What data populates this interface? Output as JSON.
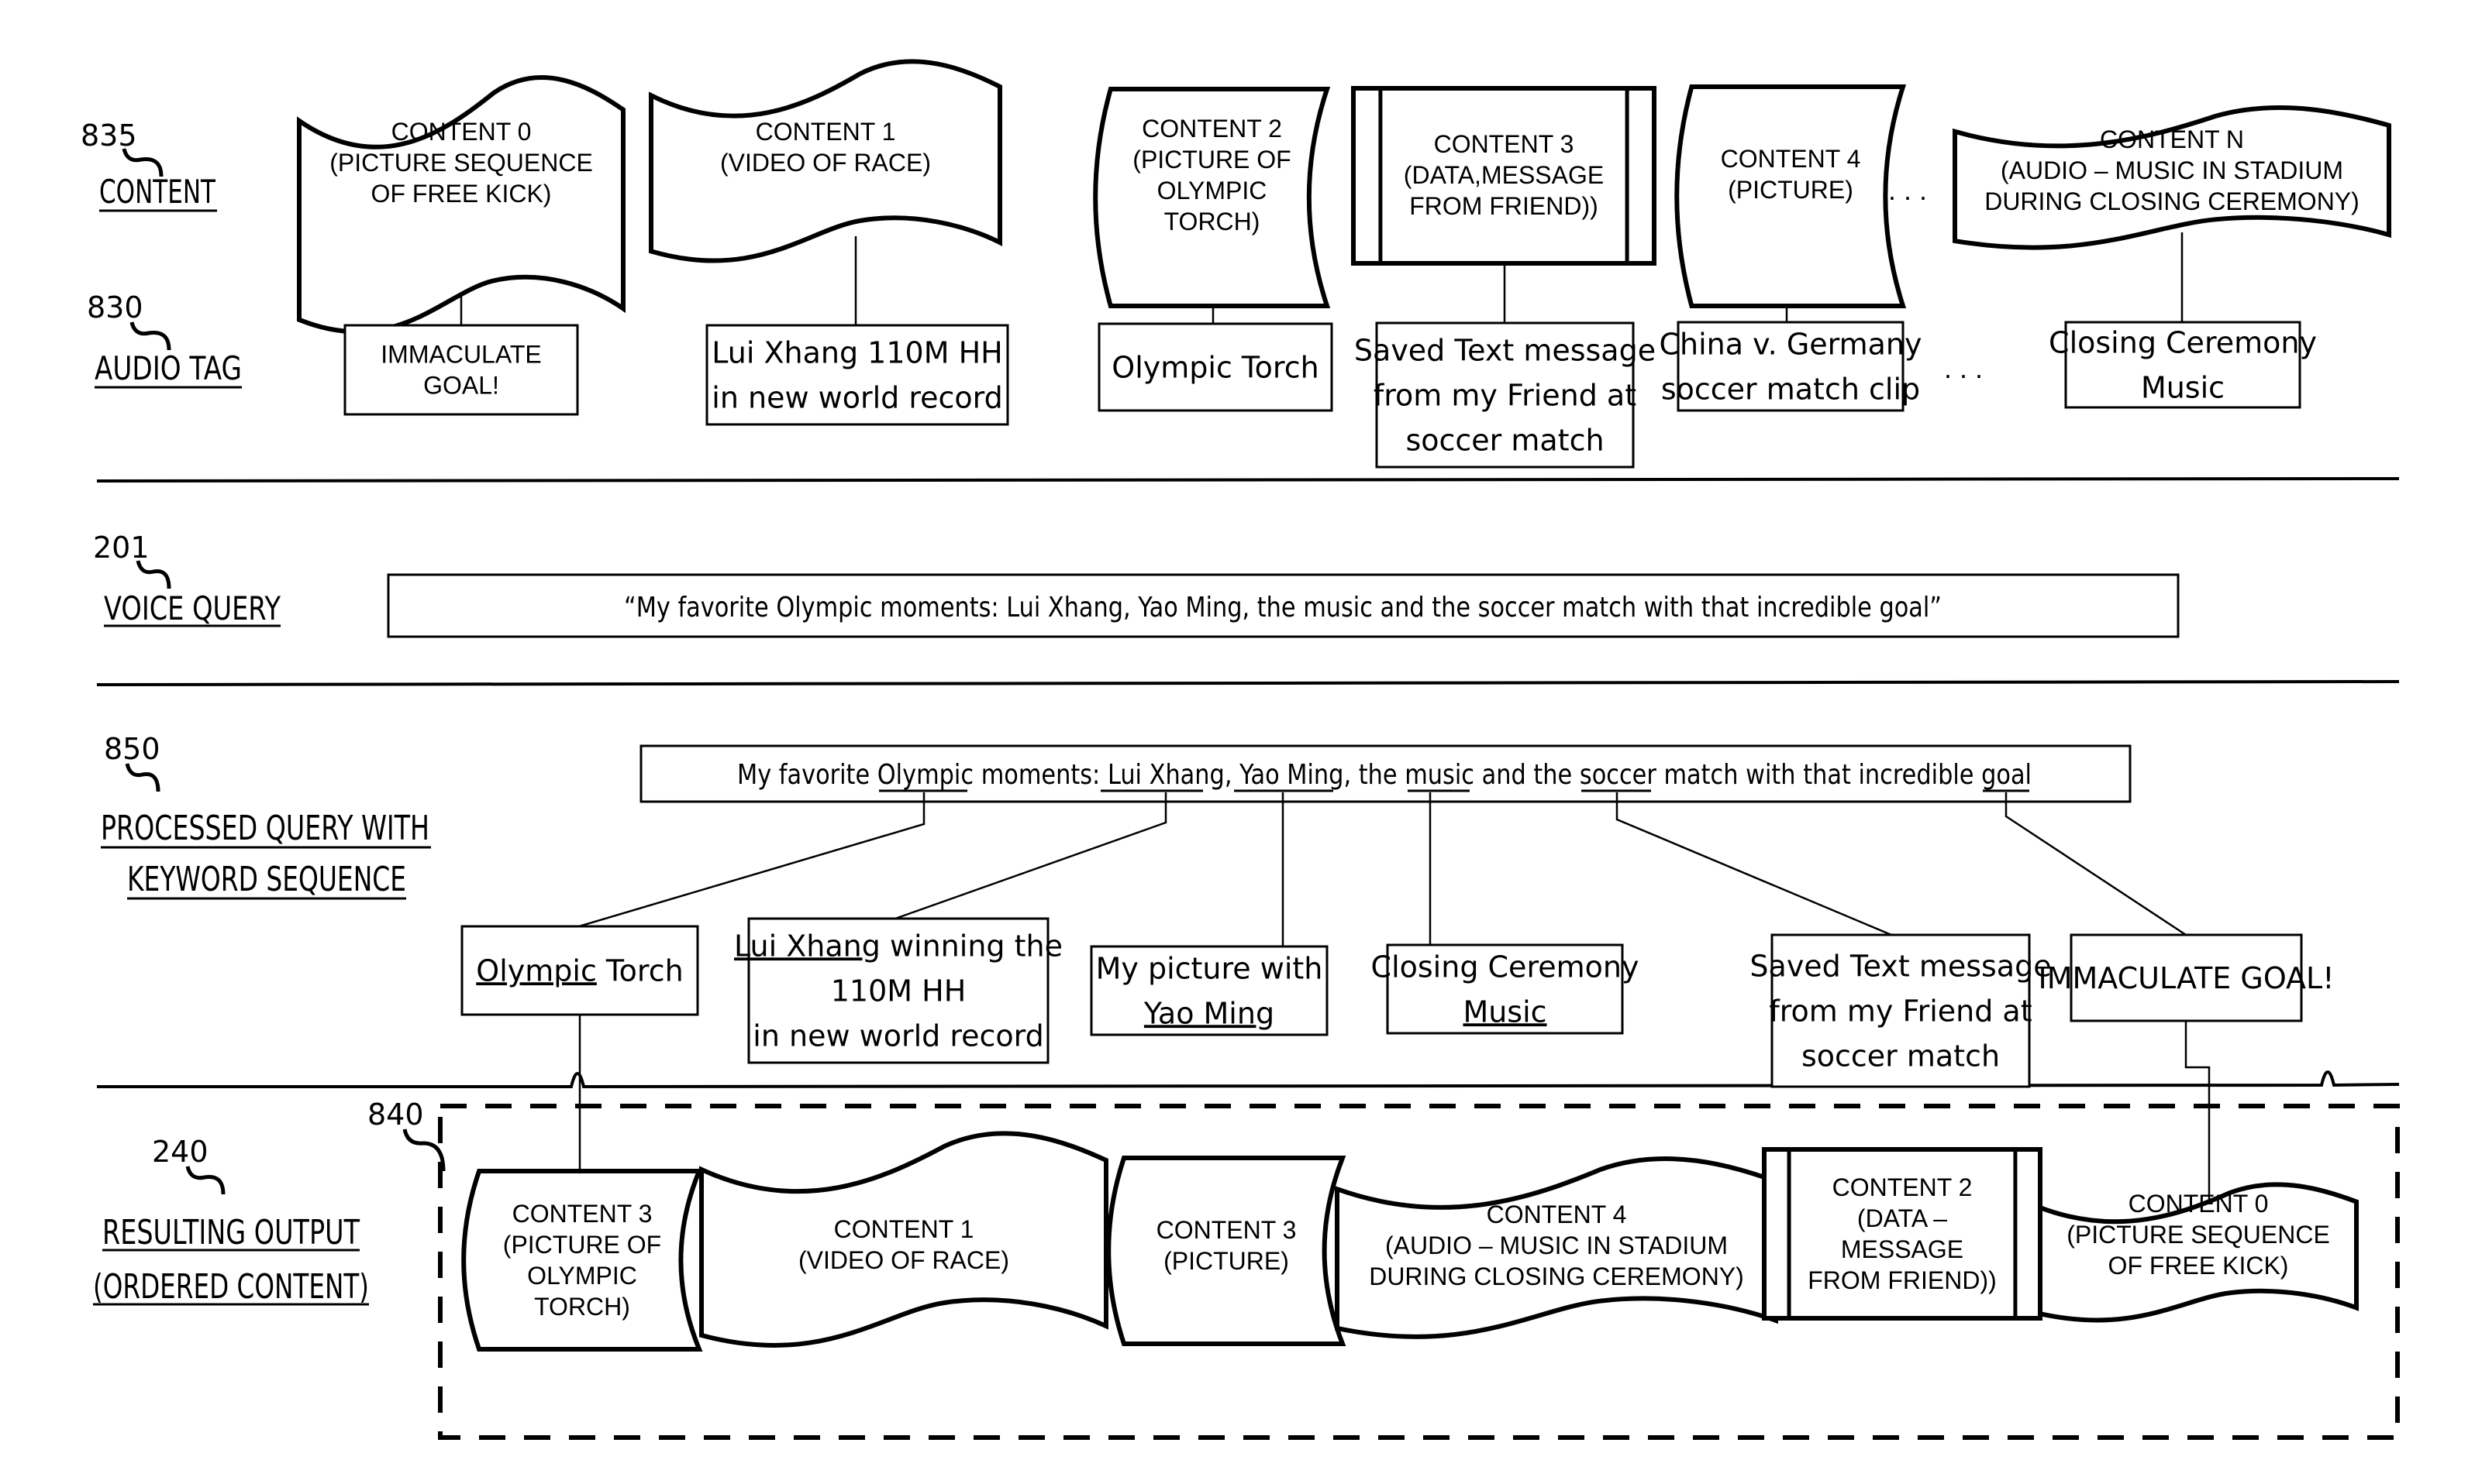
{
  "sections": {
    "content": {
      "ref": "835",
      "title": "CONTENT"
    },
    "audio_tag": {
      "ref": "830",
      "title": "AUDIO TAG"
    },
    "voice_query": {
      "ref": "201",
      "title": "VOICE QUERY"
    },
    "processed_query": {
      "ref": "850",
      "title_line1": "PROCESSED QUERY WITH",
      "title_line2": "KEYWORD SEQUENCE"
    },
    "resulting_output": {
      "ref": "240",
      "title_line1": "RESULTING OUTPUT",
      "title_line2": "(ORDERED CONTENT)",
      "container_ref": "840"
    }
  },
  "content_items": [
    {
      "lines": [
        "CONTENT 0",
        "(PICTURE SEQUENCE",
        "OF FREE KICK)"
      ],
      "shape": "wave"
    },
    {
      "lines": [
        "CONTENT 1",
        "(VIDEO OF RACE)"
      ],
      "shape": "wave"
    },
    {
      "lines": [
        "CONTENT 2",
        "(PICTURE OF",
        "OLYMPIC",
        "TORCH)"
      ],
      "shape": "stored-data"
    },
    {
      "lines": [
        "CONTENT 3",
        "(DATA,MESSAGE",
        "FROM FRIEND))"
      ],
      "shape": "predefined-process"
    },
    {
      "lines": [
        "CONTENT 4",
        "(PICTURE)"
      ],
      "shape": "stored-data"
    },
    {
      "lines": [
        "CONTENT N",
        "(AUDIO – MUSIC IN STADIUM",
        "DURING CLOSING CEREMONY)"
      ],
      "shape": "wave"
    }
  ],
  "ellipsis": ". . .",
  "audio_tags": [
    {
      "lines": [
        "IMMACULATE",
        "GOAL!"
      ]
    },
    {
      "lines": [
        "Lui Xhang 110M HH",
        "in new world record"
      ]
    },
    {
      "lines": [
        "Olympic Torch"
      ]
    },
    {
      "lines": [
        "Saved Text message",
        "from my Friend at",
        "soccer match"
      ]
    },
    {
      "lines": [
        "China v. Germany",
        "soccer match clip"
      ]
    },
    {
      "lines": [
        "Closing Ceremony",
        "Music"
      ]
    }
  ],
  "voice_query_text": "“My favorite Olympic moments: Lui Xhang, Yao Ming, the music and the soccer match with that incredible goal”",
  "processed_query": {
    "segments": [
      {
        "text": "My favorite ",
        "keyword": false
      },
      {
        "text": "Olympic",
        "keyword": true
      },
      {
        "text": " moments: ",
        "keyword": false
      },
      {
        "text": "Lui Xhang",
        "keyword": true
      },
      {
        "text": ", ",
        "keyword": false
      },
      {
        "text": "Yao Ming",
        "keyword": true
      },
      {
        "text": ", the ",
        "keyword": false
      },
      {
        "text": "music",
        "keyword": true
      },
      {
        "text": " and the ",
        "keyword": false
      },
      {
        "text": "soccer",
        "keyword": true
      },
      {
        "text": " match with that incredible ",
        "keyword": false
      },
      {
        "text": "goal",
        "keyword": true
      }
    ]
  },
  "keyword_matches": [
    {
      "lines": [
        [
          "Olympic",
          " Torch"
        ]
      ],
      "underline_first": true
    },
    {
      "lines": [
        [
          "Lui Xhang",
          " winning the"
        ],
        [
          "",
          "110M HH"
        ],
        [
          "",
          "in new world record"
        ]
      ],
      "underline_first": true
    },
    {
      "lines": [
        [
          "",
          "My picture with"
        ],
        [
          "Yao Ming",
          ""
        ]
      ],
      "underline_first": true
    },
    {
      "lines": [
        [
          "",
          "Closing Ceremony"
        ],
        [
          "Music",
          ""
        ]
      ],
      "underline_first": true
    },
    {
      "lines": [
        [
          "",
          "Saved Text message"
        ],
        [
          "",
          "from my Friend at"
        ],
        [
          "",
          "soccer match"
        ]
      ],
      "underline_first": false
    },
    {
      "lines": [
        [
          "",
          "IMMACULATE GOAL!"
        ]
      ],
      "underline_first": false
    }
  ],
  "ordered_output": [
    {
      "lines": [
        "CONTENT 3",
        "(PICTURE OF",
        "OLYMPIC",
        "TORCH)"
      ],
      "shape": "stored-data"
    },
    {
      "lines": [
        "CONTENT 1",
        "(VIDEO OF RACE)"
      ],
      "shape": "wave"
    },
    {
      "lines": [
        "CONTENT 3",
        "(PICTURE)"
      ],
      "shape": "stored-data"
    },
    {
      "lines": [
        "CONTENT 4",
        "(AUDIO – MUSIC IN STADIUM",
        "DURING CLOSING CEREMONY)"
      ],
      "shape": "wave"
    },
    {
      "lines": [
        "CONTENT 2",
        "(DATA –",
        "MESSAGE",
        "FROM FRIEND))"
      ],
      "shape": "predefined-process"
    },
    {
      "lines": [
        "CONTENT 0",
        "(PICTURE SEQUENCE",
        "OF FREE KICK)"
      ],
      "shape": "wave"
    }
  ]
}
